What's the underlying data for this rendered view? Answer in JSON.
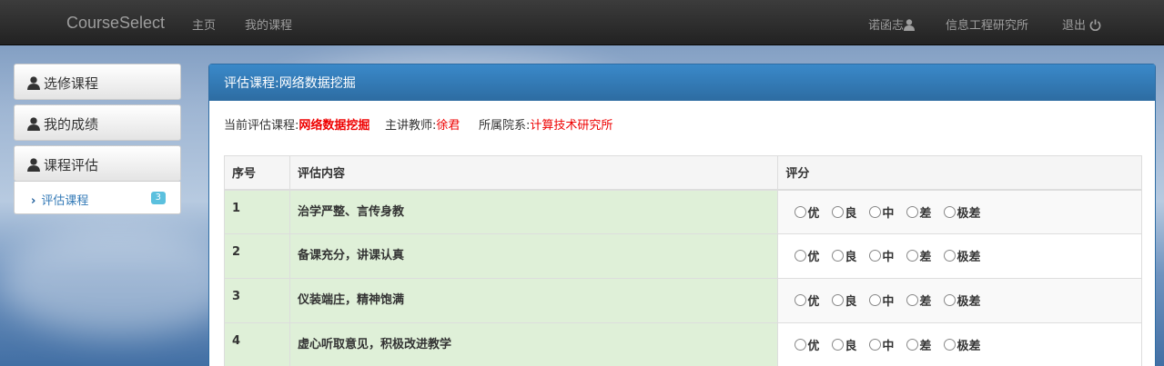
{
  "navbar": {
    "brand": "CourseSelect",
    "links": [
      "主页",
      "我的课程"
    ],
    "user": "诺函志",
    "department": "信息工程研究所",
    "logout": "退出"
  },
  "sidebar": {
    "items": [
      "选修课程",
      "我的成绩",
      "课程评估"
    ],
    "sub_item": {
      "label": "评估课程",
      "badge": "3"
    }
  },
  "panel": {
    "title": "评估课程:网络数据挖掘",
    "info": {
      "course_label": "当前评估课程:",
      "course_value": "网络数据挖掘",
      "teacher_label": "主讲教师:",
      "teacher_value": "徐君",
      "dept_label": "所属院系:",
      "dept_value": "计算技术研究所"
    },
    "table": {
      "headers": [
        "序号",
        "评估内容",
        "评分"
      ],
      "options": [
        "优",
        "良",
        "中",
        "差",
        "极差"
      ],
      "rows": [
        {
          "no": "1",
          "content": "治学严整、言传身教"
        },
        {
          "no": "2",
          "content": "备课充分，讲课认真"
        },
        {
          "no": "3",
          "content": "仪装端庄，精神饱满"
        },
        {
          "no": "4",
          "content": "虚心听取意见，积极改进教学"
        }
      ]
    }
  },
  "colors": {
    "navbar": "#222222",
    "panel_header": "#337ab7",
    "highlight_red": "#ee0000",
    "row_green": "#dff0d8",
    "badge": "#5bc0de"
  }
}
